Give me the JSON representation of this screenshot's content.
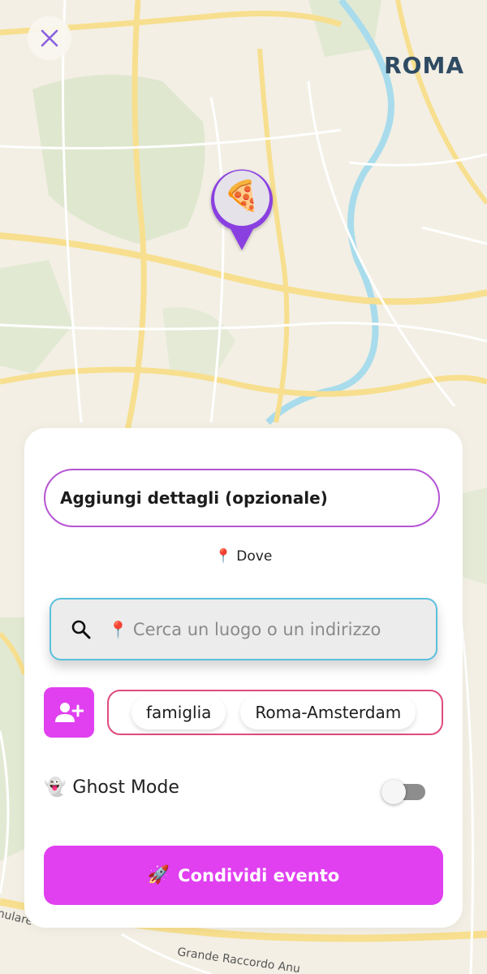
{
  "map": {
    "city_label": "ROMA",
    "road_labels": [
      "nulare",
      "Grande Raccordo Anu"
    ],
    "pin_emoji": "🍕",
    "pin_icon": "pizza-icon",
    "colors": {
      "land": "#f3efe4",
      "park": "#dfe7cf",
      "road_major": "#f7df8f",
      "road_minor": "#ffffff",
      "river": "#a8dcec",
      "pin_border": "#8a3fe0"
    }
  },
  "header": {
    "close_icon": "close-icon"
  },
  "sheet": {
    "details_placeholder": "Aggiungi dettagli (opzionale)",
    "where": {
      "emoji": "📍",
      "label": "Dove"
    },
    "search": {
      "icon": "search-icon",
      "emoji": "📍",
      "placeholder": "Cerca un luogo o un indirizzo"
    },
    "add_user_icon": "add-user-icon",
    "groups": [
      "famiglia",
      "Roma-Amsterdam"
    ],
    "ghost_mode": {
      "emoji": "👻",
      "label": "Ghost Mode",
      "enabled": false
    },
    "share_button": {
      "emoji": "🚀",
      "label": "Condividi evento"
    },
    "colors": {
      "accent": "#e040f0",
      "details_border": "#b655d4",
      "search_border": "#5bc0dd",
      "groups_border": "#de4b7f"
    }
  }
}
